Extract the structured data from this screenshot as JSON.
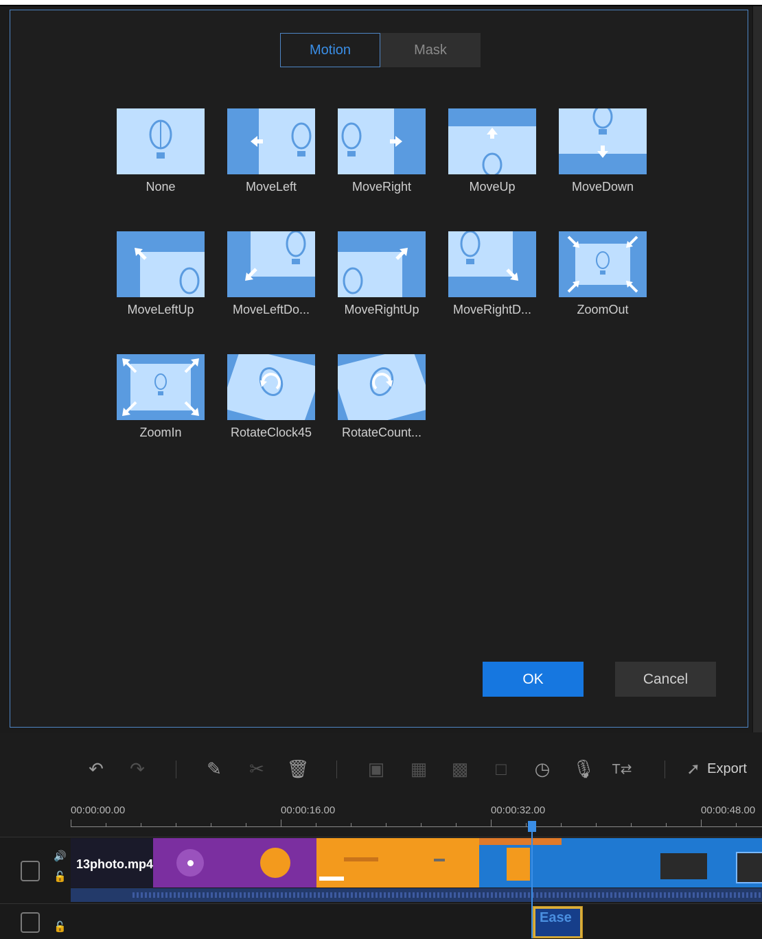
{
  "tabs": {
    "motion": "Motion",
    "mask": "Mask",
    "active": "Motion"
  },
  "effects": [
    {
      "label": "None",
      "icon": "balloon-icon",
      "selected": true
    },
    {
      "label": "MoveLeft",
      "icon": "arrow-left-icon"
    },
    {
      "label": "MoveRight",
      "icon": "arrow-right-icon"
    },
    {
      "label": "MoveUp",
      "icon": "arrow-up-icon"
    },
    {
      "label": "MoveDown",
      "icon": "arrow-down-icon"
    },
    {
      "label": "MoveLeftUp",
      "icon": "arrow-up-left-icon"
    },
    {
      "label": "MoveLeftDo...",
      "icon": "arrow-down-left-icon"
    },
    {
      "label": "MoveRightUp",
      "icon": "arrow-up-right-icon"
    },
    {
      "label": "MoveRightD...",
      "icon": "arrow-down-right-icon"
    },
    {
      "label": "ZoomOut",
      "icon": "zoom-out-icon"
    },
    {
      "label": "ZoomIn",
      "icon": "zoom-in-icon"
    },
    {
      "label": "RotateClock45",
      "icon": "rotate-clockwise-icon"
    },
    {
      "label": "RotateCount...",
      "icon": "rotate-counterclockwise-icon"
    }
  ],
  "buttons": {
    "ok": "OK",
    "cancel": "Cancel"
  },
  "toolbar": {
    "export_label": "Export",
    "icons": [
      "undo-icon",
      "redo-icon",
      "edit-icon",
      "scissors-icon",
      "delete-icon",
      "crop-icon",
      "resize-icon",
      "mosaic-icon",
      "freeze-frame-icon",
      "speed-icon",
      "voiceover-icon",
      "text-to-speech-icon",
      "export-icon"
    ]
  },
  "timeline": {
    "ticks": [
      "00:00:00.00",
      "00:00:16.00",
      "00:00:32.00",
      "00:00:48.00"
    ],
    "clip_name": "13photo.mp4",
    "overlay_clip_text": "Ease"
  },
  "colors": {
    "accent": "#1677e0",
    "tab_active_border": "#4f86c6",
    "thumb_bg": "#5a9be0",
    "thumb_light": "#bfdfff",
    "selected_outline": "#e0dc5a",
    "clip_purple": "#7b2fa0",
    "clip_orange": "#f39a1d",
    "clip_blue": "#1f79d2"
  }
}
